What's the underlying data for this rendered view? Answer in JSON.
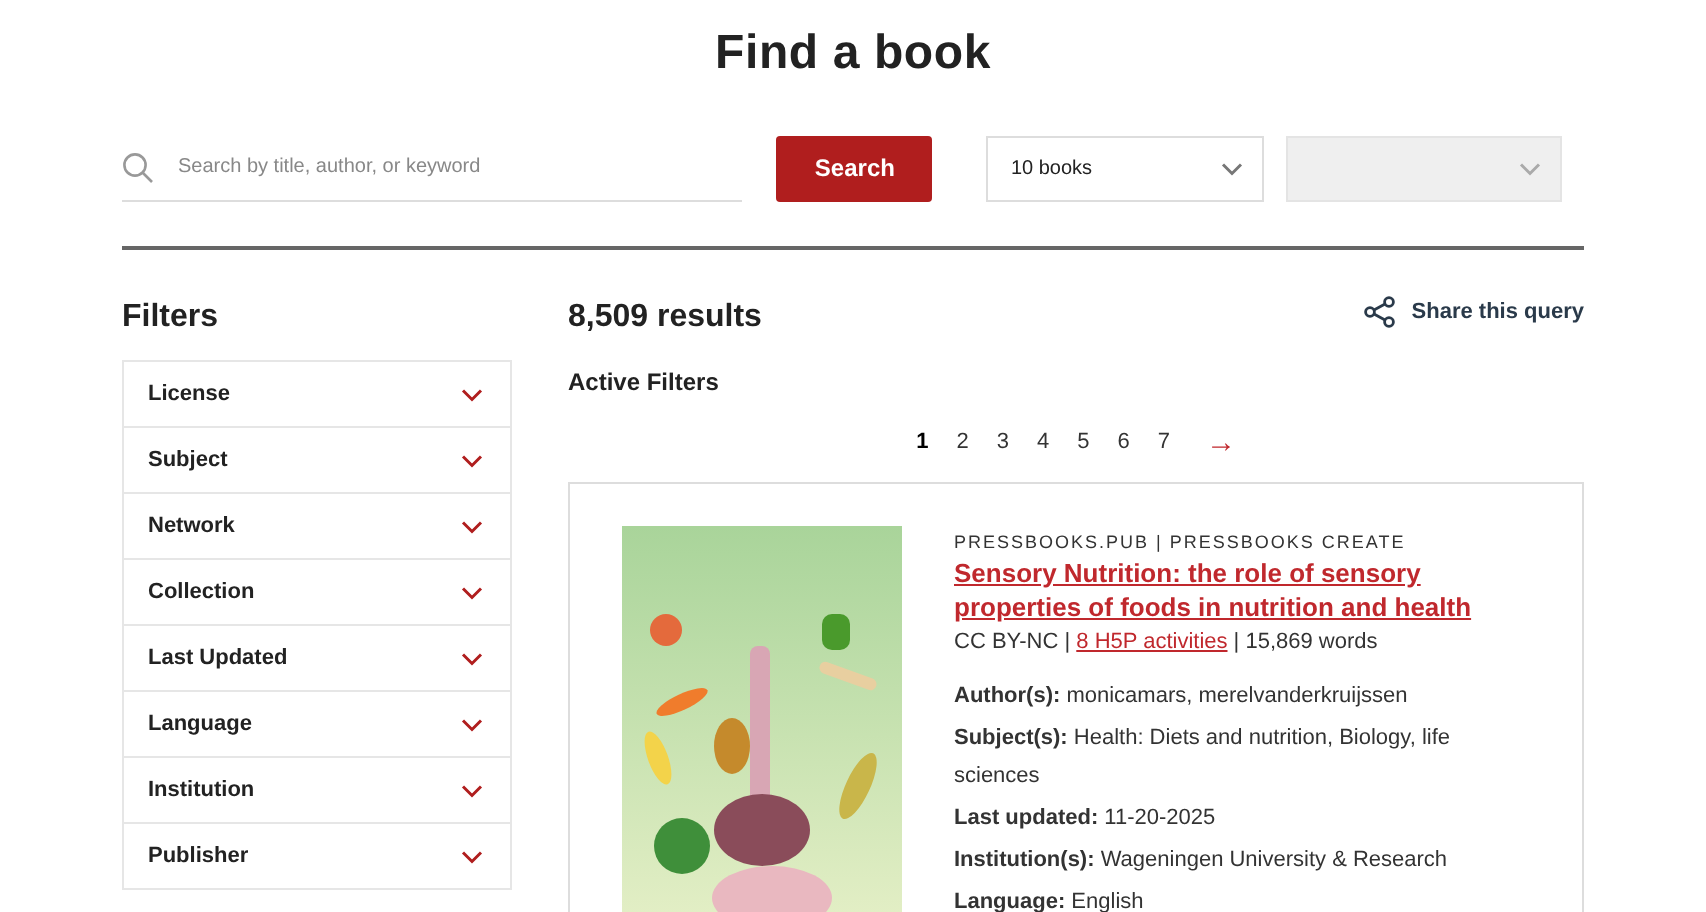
{
  "title": "Find a book",
  "search": {
    "placeholder": "Search by title, author, or keyword",
    "button": "Search"
  },
  "selects": [
    {
      "value": "10 books",
      "disabled": false
    },
    {
      "disabled": true
    }
  ],
  "filters": {
    "heading": "Filters",
    "items": [
      {
        "label": "License",
        "expanded": false
      },
      {
        "label": "Subject",
        "expanded": false
      },
      {
        "label": "Network",
        "expanded": false
      },
      {
        "label": "Collection",
        "expanded": false
      },
      {
        "label": "Last Updated",
        "expanded": false
      },
      {
        "label": "Language",
        "expanded": false
      },
      {
        "label": "Institution",
        "expanded": false
      },
      {
        "label": "Publisher",
        "expanded": false
      }
    ]
  },
  "results": {
    "count": "8,509 results",
    "share": "Share this query",
    "active_filters": "Active Filters",
    "pages": [
      {
        "label": "1",
        "selected": true
      },
      {
        "label": "2",
        "selected": false
      },
      {
        "label": "3",
        "selected": false
      },
      {
        "label": "4",
        "selected": false
      },
      {
        "label": "5",
        "selected": false
      },
      {
        "label": "6",
        "selected": false
      },
      {
        "label": "7",
        "selected": false
      }
    ],
    "next": "→",
    "books": [
      {
        "source": "PRESSBOOKS.PUB | PRESSBOOKS CREATE",
        "title": "Sensory Nutrition: the role of sensory properties of foods in nutrition and health",
        "license": "CC BY-NC |",
        "activities": "8 H5P activities",
        "words": "| 15,869 words",
        "details": [
          {
            "label": "Author(s):",
            "value": "monicamars, merelvanderkruijssen"
          },
          {
            "label": "Subject(s):",
            "value": "Health: Diets and nutrition, Biology, life sciences"
          },
          {
            "label": "Last updated:",
            "value": "11-20-2025"
          },
          {
            "label": "Institution(s):",
            "value": "Wageningen University & Research"
          },
          {
            "label": "Language:",
            "value": "English"
          }
        ]
      }
    ]
  }
}
